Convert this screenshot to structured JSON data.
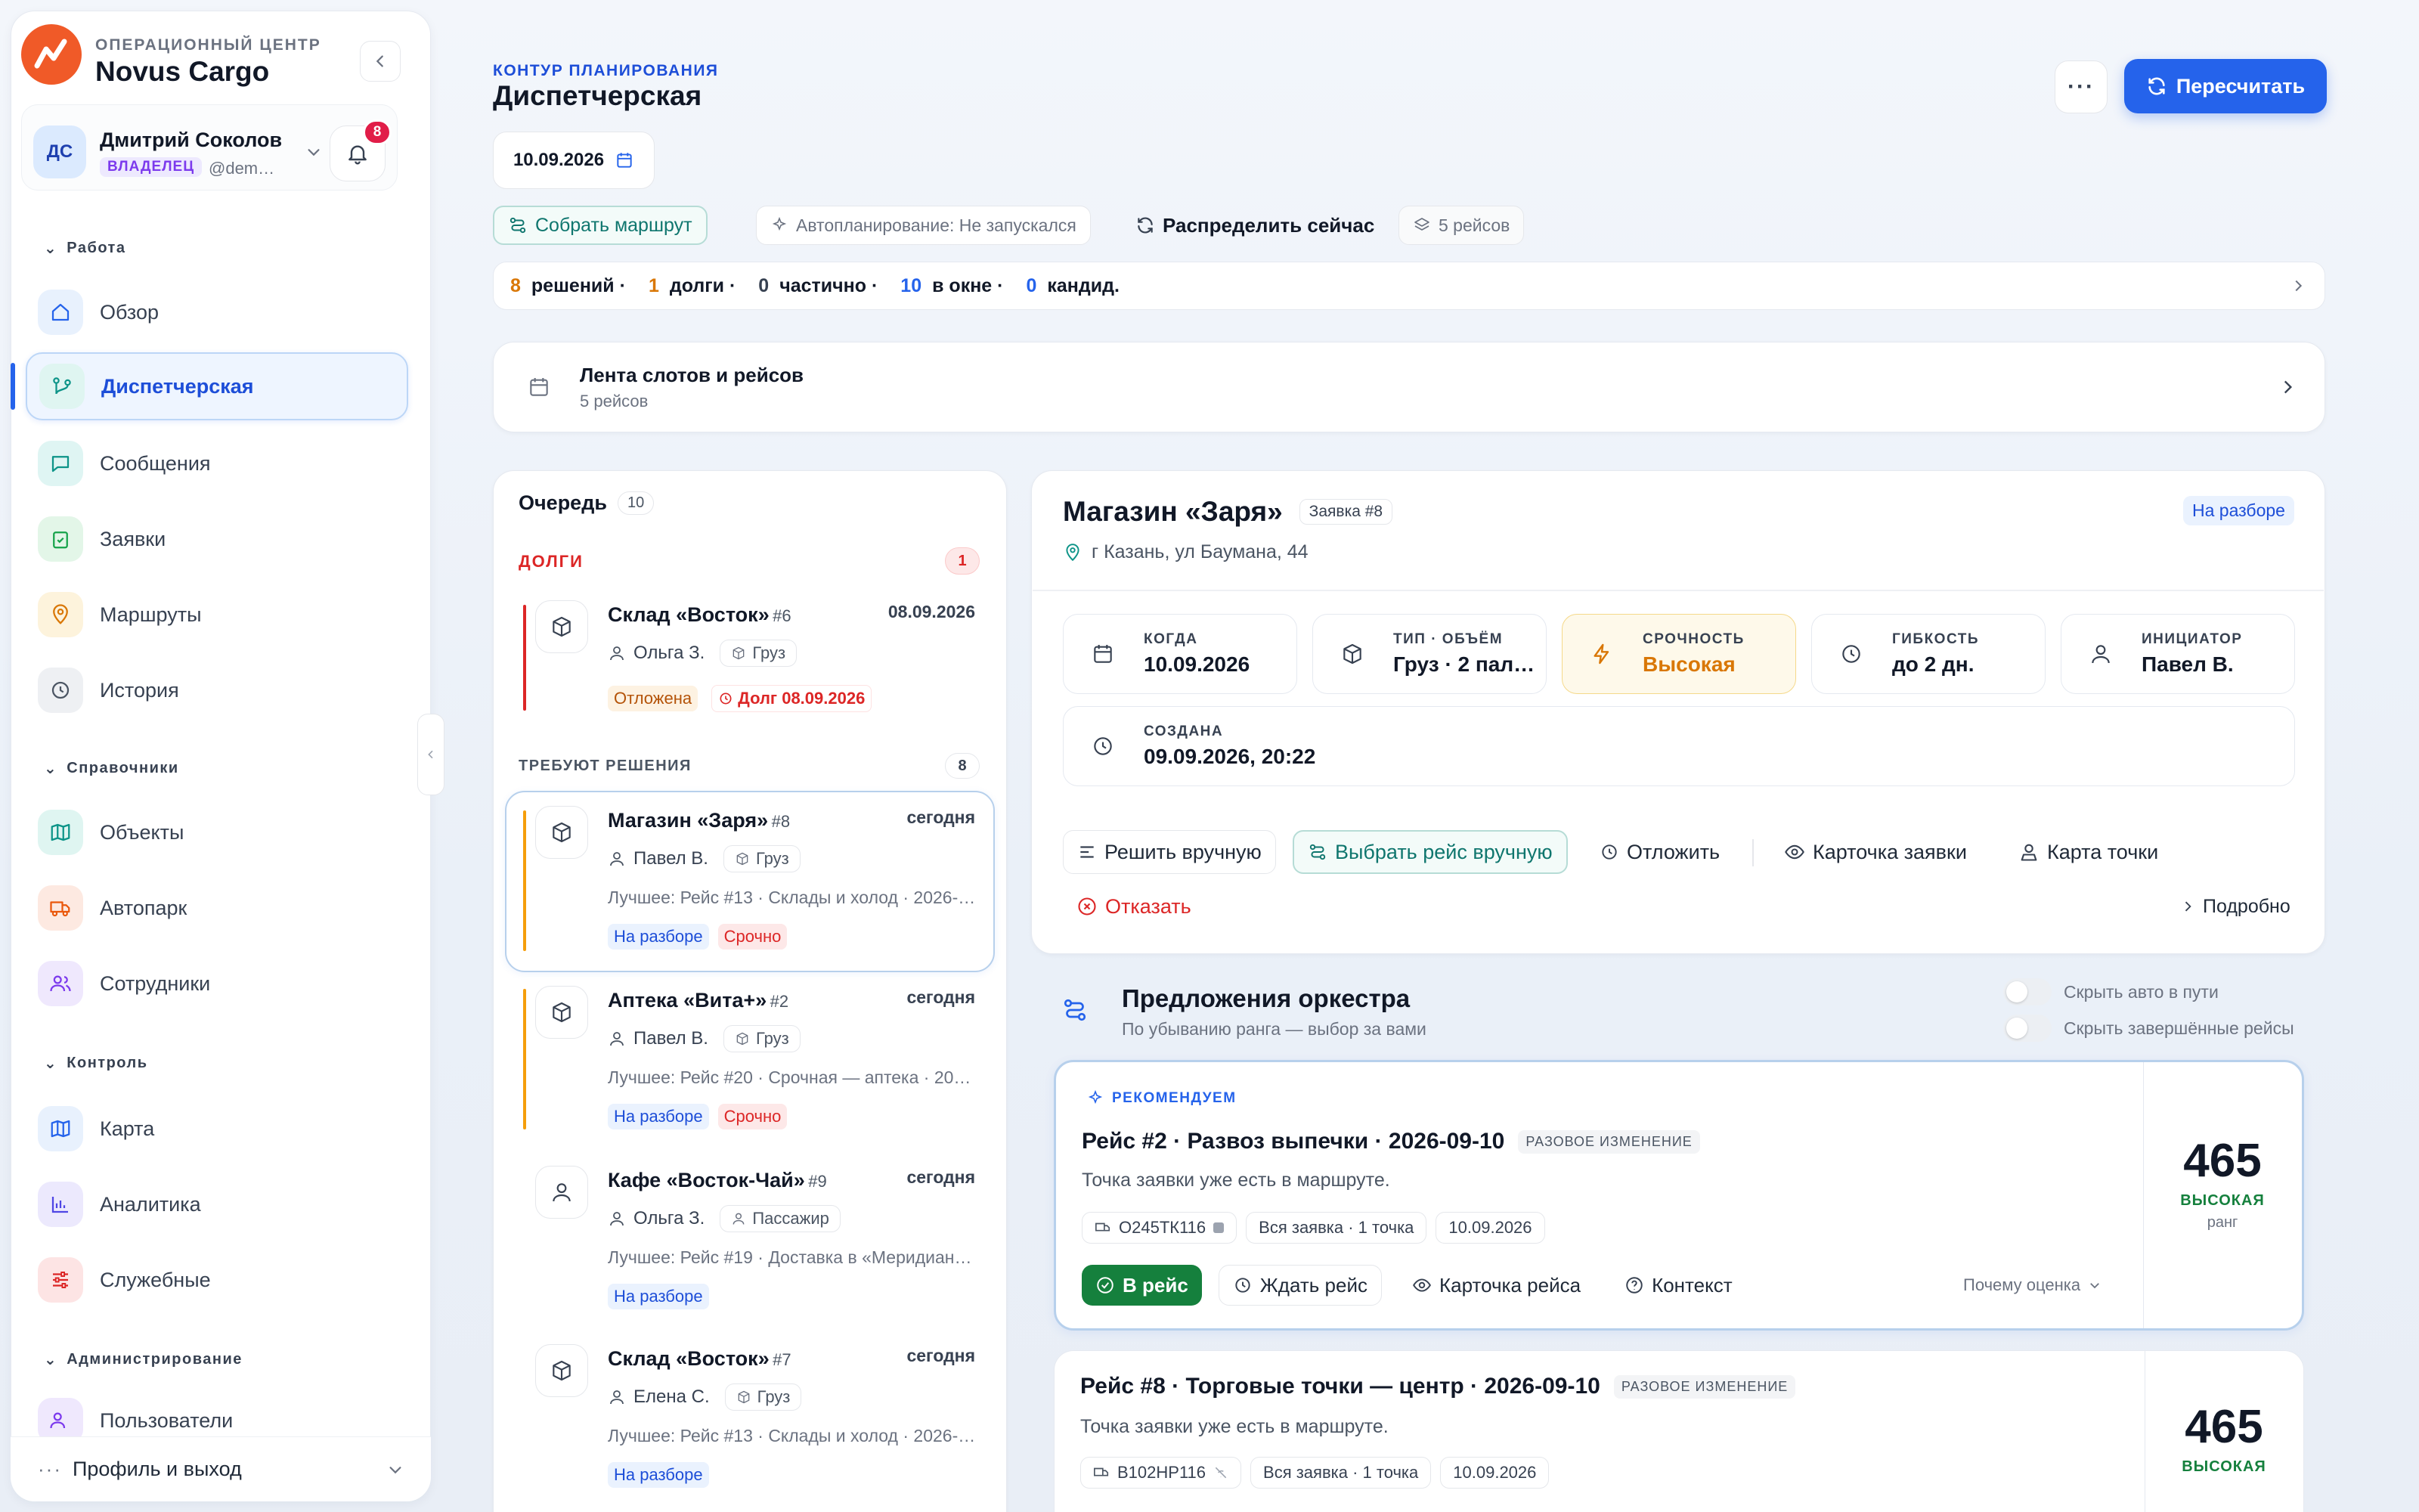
{
  "brand": {
    "subtitle": "ОПЕРАЦИОННЫЙ ЦЕНТР",
    "name": "Novus Cargo"
  },
  "user": {
    "initials": "ДС",
    "name": "Дмитрий Соколов",
    "role": "ВЛАДЕЛЕЦ",
    "handle": "@dem…",
    "notifications": "8"
  },
  "nav": {
    "sections": [
      "Работа",
      "Справочники",
      "Контроль",
      "Администрирование"
    ],
    "items": [
      "Обзор",
      "Диспетчерская",
      "Сообщения",
      "Заявки",
      "Маршруты",
      "История",
      "Объекты",
      "Автопарк",
      "Сотрудники",
      "Карта",
      "Аналитика",
      "Служебные",
      "Пользователи"
    ],
    "profile": "Профиль и выход"
  },
  "header": {
    "kicker": "КОНТУР ПЛАНИРОВАНИЯ",
    "title": "Диспетчерская",
    "recalc": "Пересчитать",
    "date": "10.09.2026"
  },
  "toolbar": {
    "collect": "Собрать маршрут",
    "autoplan": "Автопланирование: Не запускался",
    "distribute": "Распределить сейчас",
    "trips": "5 рейсов"
  },
  "stats": {
    "decisions_n": "8",
    "decisions": "решений ·",
    "debts_n": "1",
    "debts": "долги ·",
    "partial_n": "0",
    "partial": "частично ·",
    "window_n": "10",
    "window": "в окне ·",
    "cand_n": "0",
    "cand": "кандид."
  },
  "feed": {
    "title": "Лента слотов и рейсов",
    "sub": "5 рейсов"
  },
  "queue": {
    "title": "Очередь",
    "count": "10",
    "debts_label": "ДОЛГИ",
    "debts_count": "1",
    "need_label": "ТРЕБУЮТ РЕШЕНИЯ",
    "need_count": "8",
    "items": [
      {
        "title": "Склад «Восток»",
        "num": "#6",
        "date": "08.09.2026",
        "person": "Ольга З.",
        "kind": "Груз",
        "best": "",
        "tag1": "Отложена",
        "tag2": "Долг 08.09.2026"
      },
      {
        "title": "Магазин «Заря»",
        "num": "#8",
        "date": "сегодня",
        "person": "Павел В.",
        "kind": "Груз",
        "best": "Лучшее: Рейс #13 · Склады и холод · 2026-…",
        "tag1": "На разборе",
        "tag2": "Срочно"
      },
      {
        "title": "Аптека «Вита+»",
        "num": "#2",
        "date": "сегодня",
        "person": "Павел В.",
        "kind": "Груз",
        "best": "Лучшее: Рейс #20 · Срочная — аптека · 20…",
        "tag1": "На разборе",
        "tag2": "Срочно"
      },
      {
        "title": "Кафе «Восток-Чай»",
        "num": "#9",
        "date": "сегодня",
        "person": "Ольга З.",
        "kind": "Пассажир",
        "best": "Лучшее: Рейс #19 · Доставка в «Меридиан…",
        "tag1": "На разборе",
        "tag2": ""
      },
      {
        "title": "Склад «Восток»",
        "num": "#7",
        "date": "сегодня",
        "person": "Елена С.",
        "kind": "Груз",
        "best": "Лучшее: Рейс #13 · Склады и холод · 2026-…",
        "tag1": "На разборе",
        "tag2": ""
      }
    ]
  },
  "detail": {
    "title": "Магазин «Заря»",
    "request": "Заявка #8",
    "status": "На разборе",
    "address": "г Казань, ул Баумана, 44",
    "tiles": [
      {
        "label": "КОГДА",
        "value": "10.09.2026"
      },
      {
        "label": "ТИП · ОБЪЁМ",
        "value": "Груз · 2 пал…"
      },
      {
        "label": "СРОЧНОСТЬ",
        "value": "Высокая"
      },
      {
        "label": "ГИБКОСТЬ",
        "value": "до 2 дн."
      },
      {
        "label": "ИНИЦИАТОР",
        "value": "Павел В."
      },
      {
        "label": "СОЗДАНА",
        "value": "09.09.2026, 20:22"
      }
    ],
    "actions": {
      "manual": "Решить вручную",
      "pick": "Выбрать рейс вручную",
      "postpone": "Отложить",
      "card": "Карточка заявки",
      "map": "Карта точки",
      "reject": "Отказать",
      "more": "Подробно"
    }
  },
  "proposals": {
    "title": "Предложения оркестра",
    "sub": "По убыванию ранга — выбор за вами",
    "toggle1": "Скрыть авто в пути",
    "toggle2": "Скрыть завершённые рейсы",
    "cards": [
      {
        "recommended": "РЕКОМЕНДУЕМ",
        "title": "Рейс #2 · Развоз выпечки · 2026-09-10",
        "badge": "РАЗОВОЕ ИЗМЕНЕНИЕ",
        "note": "Точка заявки уже есть в маршруте.",
        "plate": "О245ТК116",
        "scope": "Вся заявка · 1 точка",
        "date": "10.09.2026",
        "score": "465",
        "level": "ВЫСОКАЯ",
        "rank": "ранг",
        "btn_in": "В рейс",
        "btn_wait": "Ждать рейс",
        "btn_card": "Карточка рейса",
        "btn_ctx": "Контекст",
        "why": "Почему оценка"
      },
      {
        "title": "Рейс #8 · Торговые точки — центр · 2026-09-10",
        "badge": "РАЗОВОЕ ИЗМЕНЕНИЕ",
        "note": "Точка заявки уже есть в маршруте.",
        "plate": "В102НР116",
        "scope": "Вся заявка · 1 точка",
        "date": "10.09.2026",
        "score": "465",
        "level": "ВЫСОКАЯ"
      }
    ]
  },
  "colors": {
    "accent": "#2563eb",
    "danger": "#dc2626",
    "warning": "#d97706",
    "success": "#16a34a",
    "brand": "#f05a28"
  }
}
